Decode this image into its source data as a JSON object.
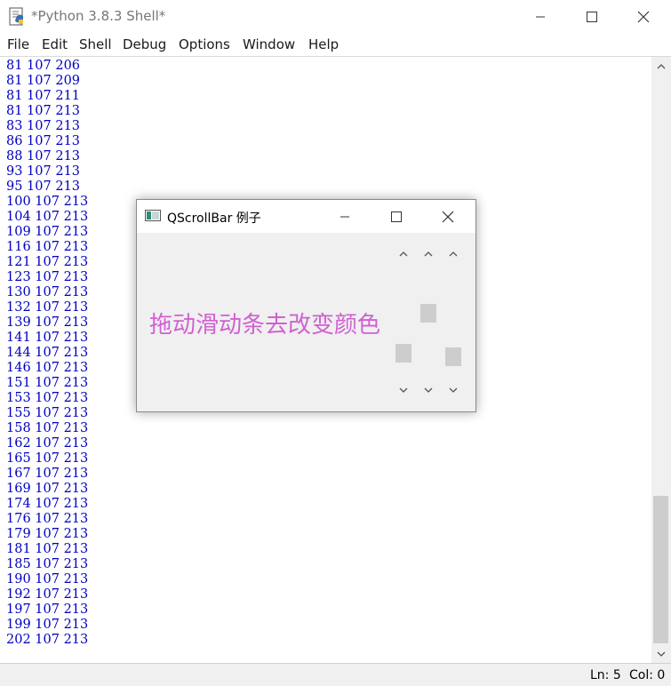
{
  "window": {
    "title": "*Python 3.8.3 Shell*",
    "icon": "python-file-icon"
  },
  "menu": [
    "File",
    "Edit",
    "Shell",
    "Debug",
    "Options",
    "Window",
    "Help"
  ],
  "shell": {
    "text_color": "#0000c0",
    "lines": [
      "81 107 206",
      "81 107 209",
      "81 107 211",
      "81 107 213",
      "83 107 213",
      "86 107 213",
      "88 107 213",
      "93 107 213",
      "95 107 213",
      "100 107 213",
      "104 107 213",
      "109 107 213",
      "116 107 213",
      "121 107 213",
      "123 107 213",
      "130 107 213",
      "132 107 213",
      "139 107 213",
      "141 107 213",
      "144 107 213",
      "146 107 213",
      "151 107 213",
      "153 107 213",
      "155 107 213",
      "158 107 213",
      "162 107 213",
      "165 107 213",
      "167 107 213",
      "169 107 213",
      "174 107 213",
      "176 107 213",
      "179 107 213",
      "181 107 213",
      "185 107 213",
      "190 107 213",
      "192 107 213",
      "197 107 213",
      "199 107 213",
      "202 107 213"
    ]
  },
  "status": {
    "line": "Ln: 5",
    "col": "Col: 0"
  },
  "dialog": {
    "title": "QScrollBar 例子",
    "label": "拖动滑动条去改变颜色",
    "label_color": "#d160d1",
    "scrollbars": [
      {
        "name": "red",
        "value_fraction": 0.81
      },
      {
        "name": "green",
        "value_fraction": 0.42
      },
      {
        "name": "blue",
        "value_fraction": 0.84
      }
    ]
  }
}
